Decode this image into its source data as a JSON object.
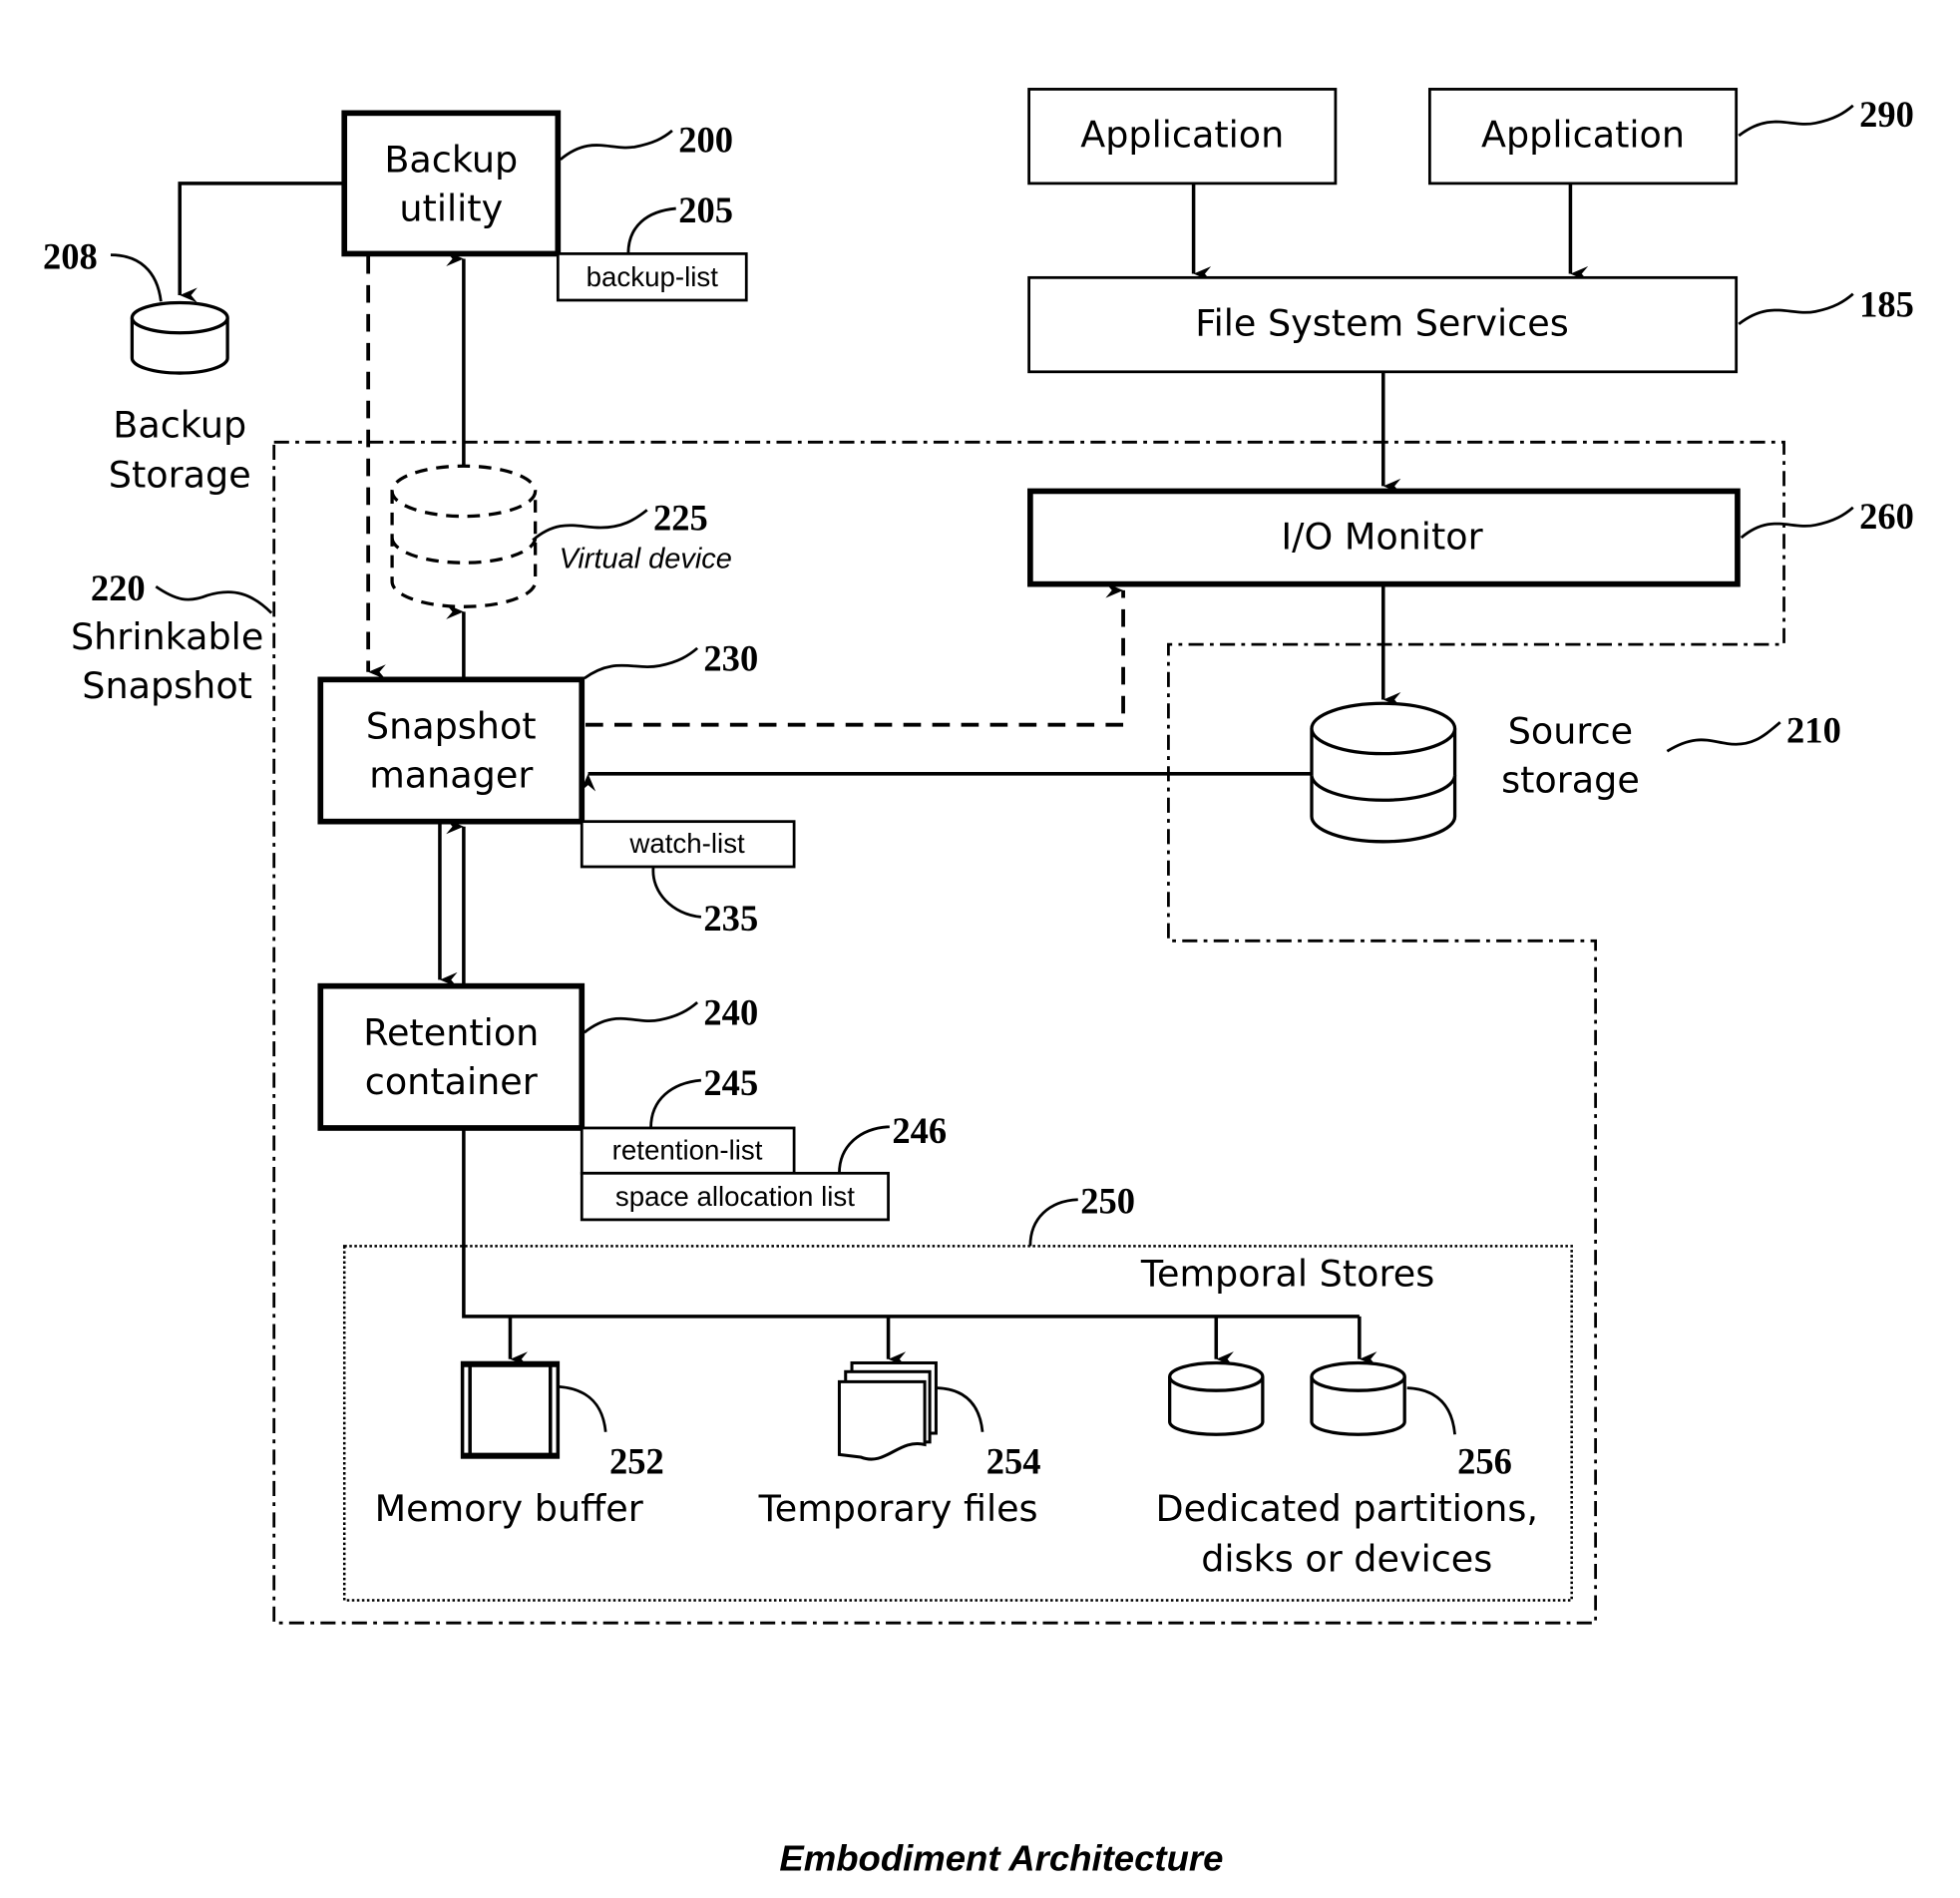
{
  "diagram": {
    "caption": "Embodiment Architecture",
    "components": {
      "backup_utility": {
        "line1": "Backup",
        "line2": "utility",
        "ref": "200"
      },
      "backup_list": {
        "label": "backup-list",
        "ref": "205"
      },
      "backup_storage": {
        "line1": "Backup",
        "line2": "Storage",
        "ref": "208"
      },
      "application_1": {
        "label": "Application"
      },
      "application_2": {
        "label": "Application",
        "ref": "290"
      },
      "file_system_services": {
        "label": "File System Services",
        "ref": "185"
      },
      "io_monitor": {
        "label": "I/O Monitor",
        "ref": "260"
      },
      "virtual_device": {
        "label": "Virtual device",
        "ref": "225"
      },
      "shrinkable_snapshot": {
        "line1": "Shrinkable",
        "line2": "Snapshot",
        "ref": "220"
      },
      "snapshot_manager": {
        "line1": "Snapshot",
        "line2": "manager",
        "ref": "230"
      },
      "watch_list": {
        "label": "watch-list",
        "ref": "235"
      },
      "source_storage": {
        "line1": "Source",
        "line2": "storage",
        "ref": "210"
      },
      "retention_container": {
        "line1": "Retention",
        "line2": "container",
        "ref": "240"
      },
      "retention_list": {
        "label": "retention-list",
        "ref": "245"
      },
      "space_allocation_list": {
        "label": "space allocation list",
        "ref": "246"
      },
      "temporal_stores": {
        "label": "Temporal Stores",
        "ref": "250"
      },
      "memory_buffer": {
        "label": "Memory buffer",
        "ref": "252"
      },
      "temporary_files": {
        "label": "Temporary files",
        "ref": "254"
      },
      "dedicated_partitions": {
        "line1": "Dedicated partitions,",
        "line2": "disks or devices",
        "ref": "256"
      }
    }
  }
}
